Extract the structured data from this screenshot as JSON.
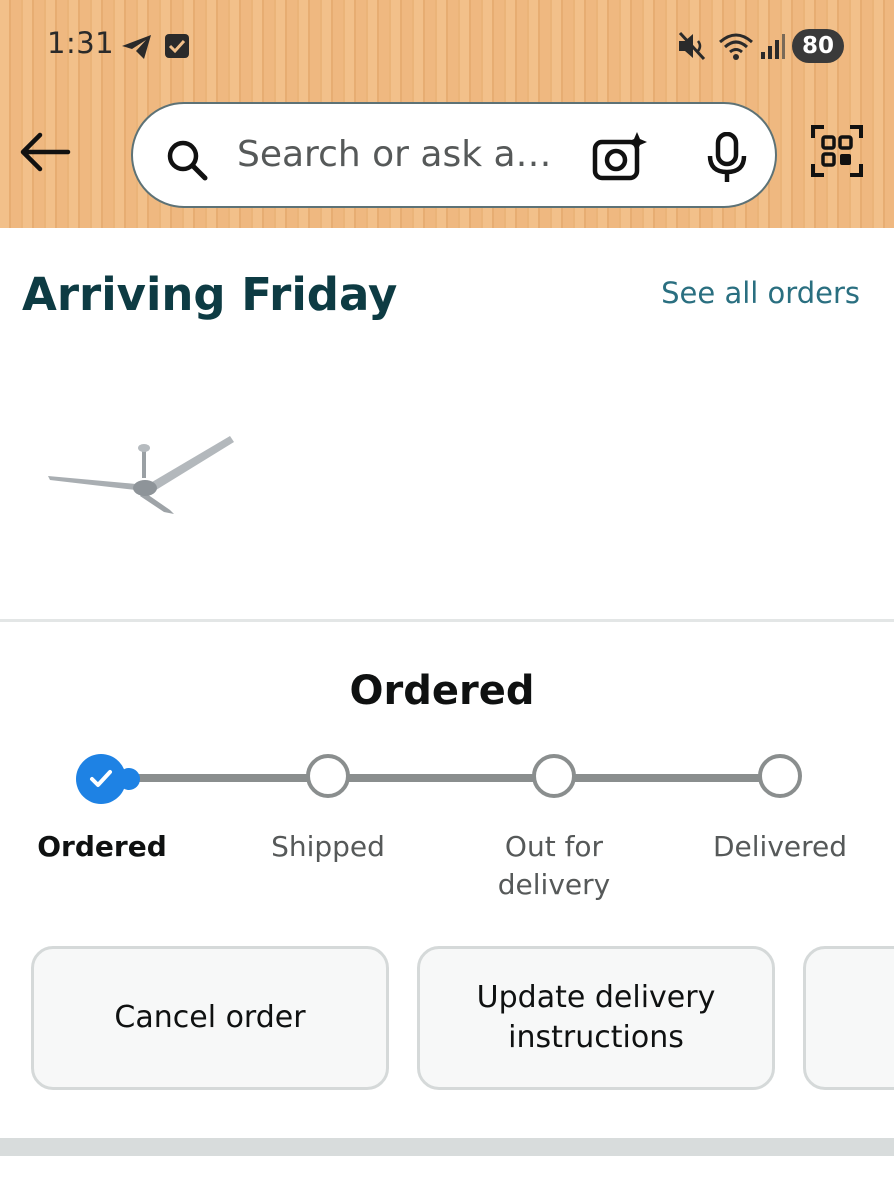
{
  "status_bar": {
    "time": "1:31",
    "battery": "80",
    "icons": [
      "telegram-icon",
      "check-box-icon",
      "mute-icon",
      "wifi-icon",
      "signal-icon"
    ]
  },
  "search": {
    "placeholder": "Search or ask a…"
  },
  "order": {
    "heading": "Arriving Friday",
    "see_all": "See all orders",
    "product_image": "ceiling-fan"
  },
  "tracker": {
    "title": "Ordered",
    "steps": [
      {
        "label": "Ordered",
        "state": "done"
      },
      {
        "label": "Shipped",
        "state": "pending"
      },
      {
        "label": "Out for delivery",
        "state": "pending"
      },
      {
        "label": "Delivered",
        "state": "pending"
      }
    ]
  },
  "actions": [
    {
      "label": "Cancel order"
    },
    {
      "label": "Update delivery instructions"
    }
  ],
  "colors": {
    "accent": "#1e82e4",
    "heading": "#0d3b43",
    "link": "#2a6f80"
  }
}
